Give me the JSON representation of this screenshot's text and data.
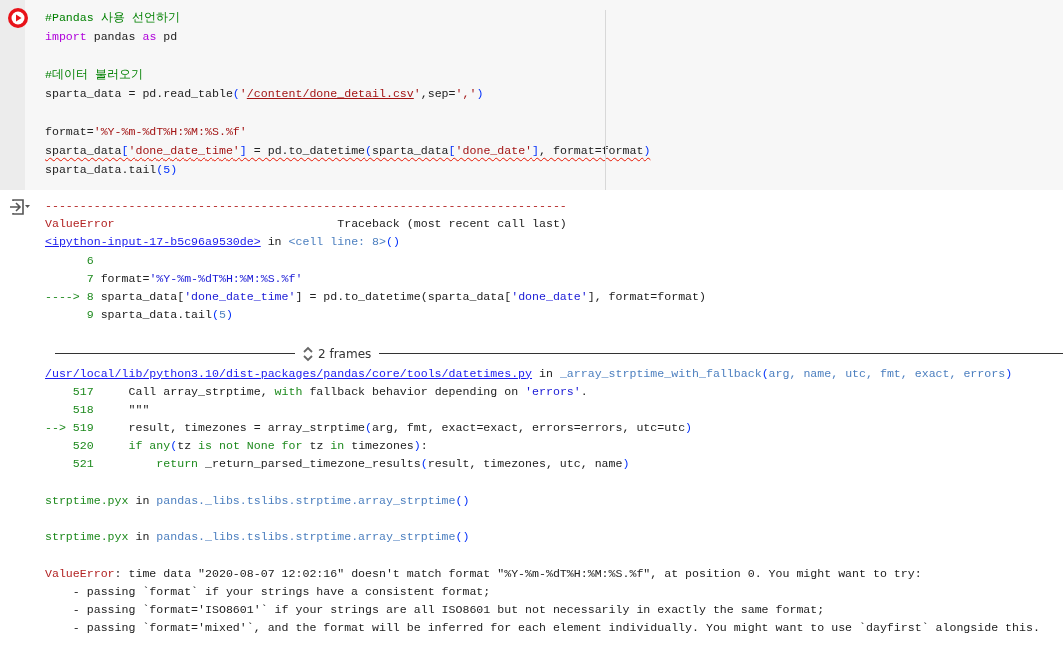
{
  "cell": {
    "lines": [
      {
        "kind": "code",
        "tokens": [
          {
            "kind": "comment",
            "text": "#Pandas 사용 선언하기"
          }
        ]
      },
      {
        "kind": "code",
        "tokens": [
          {
            "kind": "keyword",
            "text": "import"
          },
          {
            "kind": "plain",
            "text": " pandas "
          },
          {
            "kind": "keyword",
            "text": "as"
          },
          {
            "kind": "plain",
            "text": " pd"
          }
        ]
      },
      {
        "kind": "blank"
      },
      {
        "kind": "code",
        "tokens": [
          {
            "kind": "comment",
            "text": "#데이터 불러오기"
          }
        ]
      },
      {
        "kind": "code",
        "tokens": [
          {
            "kind": "plain",
            "text": "sparta_data = pd.read_table"
          },
          {
            "kind": "paren",
            "text": "("
          },
          {
            "kind": "string",
            "text": "'"
          },
          {
            "kind": "strlink",
            "text": "/content/done_detail.csv"
          },
          {
            "kind": "string",
            "text": "'"
          },
          {
            "kind": "plain",
            "text": ",sep="
          },
          {
            "kind": "string",
            "text": "','"
          },
          {
            "kind": "paren",
            "text": ")"
          }
        ]
      },
      {
        "kind": "blank"
      },
      {
        "kind": "code",
        "tokens": [
          {
            "kind": "plain",
            "text": "format="
          },
          {
            "kind": "string",
            "text": "'%Y-%m-%dT%H:%M:%S.%f'"
          }
        ]
      },
      {
        "kind": "code",
        "squiggle": true,
        "tokens": [
          {
            "kind": "plain",
            "text": "sparta_data"
          },
          {
            "kind": "paren",
            "text": "["
          },
          {
            "kind": "string",
            "text": "'done_date_time'"
          },
          {
            "kind": "paren",
            "text": "]"
          },
          {
            "kind": "plain",
            "text": " = pd.to_datetime"
          },
          {
            "kind": "paren",
            "text": "("
          },
          {
            "kind": "plain",
            "text": "sparta_data"
          },
          {
            "kind": "paren",
            "text": "["
          },
          {
            "kind": "string",
            "text": "'done_date'"
          },
          {
            "kind": "paren",
            "text": "]"
          },
          {
            "kind": "plain",
            "text": ", format=format"
          },
          {
            "kind": "paren",
            "text": ")"
          }
        ]
      },
      {
        "kind": "code",
        "tokens": [
          {
            "kind": "plain",
            "text": "sparta_data.tail"
          },
          {
            "kind": "paren",
            "text": "("
          },
          {
            "kind": "number",
            "text": "5"
          },
          {
            "kind": "paren",
            "text": ")"
          }
        ]
      }
    ]
  },
  "output": {
    "lines": [
      {
        "kind": "line",
        "tokens": [
          {
            "kind": "err",
            "text": "---------------------------------------------------------------------------"
          }
        ]
      },
      {
        "kind": "line",
        "tokens": [
          {
            "kind": "err",
            "text": "ValueError"
          },
          {
            "kind": "plain",
            "text": "                                Traceback (most recent call last)"
          }
        ]
      },
      {
        "kind": "line",
        "link": "<ipython-input-17-b5c96a9530de>",
        "tokens": [
          {
            "kind": "plain",
            "text": " in "
          },
          {
            "kind": "func",
            "text": "<cell line: 8>"
          },
          {
            "kind": "paren",
            "text": "()"
          }
        ]
      },
      {
        "kind": "line",
        "tokens": [
          {
            "kind": "green",
            "text": "      6"
          }
        ]
      },
      {
        "kind": "line",
        "tokens": [
          {
            "kind": "green",
            "text": "      7"
          },
          {
            "kind": "plain",
            "text": " format="
          },
          {
            "kind": "str2",
            "text": "'%Y-%m-%dT%H:%M:%S.%f'"
          }
        ]
      },
      {
        "kind": "line",
        "tokens": [
          {
            "kind": "green",
            "text": "----> 8"
          },
          {
            "kind": "plain",
            "text": " sparta_data["
          },
          {
            "kind": "str2",
            "text": "'done_date_time'"
          },
          {
            "kind": "plain",
            "text": "] = pd.to_datetime(sparta_data["
          },
          {
            "kind": "str2",
            "text": "'done_date'"
          },
          {
            "kind": "plain",
            "text": "], format=format)"
          }
        ]
      },
      {
        "kind": "line",
        "tokens": [
          {
            "kind": "green",
            "text": "      9"
          },
          {
            "kind": "plain",
            "text": " sparta_data.tail"
          },
          {
            "kind": "paren",
            "text": "("
          },
          {
            "kind": "func",
            "text": "5"
          },
          {
            "kind": "paren",
            "text": ")"
          }
        ]
      },
      {
        "kind": "blank"
      },
      {
        "kind": "frames",
        "text": "2 frames"
      },
      {
        "kind": "line",
        "link": "/usr/local/lib/python3.10/dist-packages/pandas/core/tools/datetimes.py",
        "tokens": [
          {
            "kind": "plain",
            "text": " in "
          },
          {
            "kind": "func",
            "text": "_array_strptime_with_fallback"
          },
          {
            "kind": "paren",
            "text": "("
          },
          {
            "kind": "func",
            "text": "arg, name, utc, fmt, exact, errors"
          },
          {
            "kind": "paren",
            "text": ")"
          }
        ]
      },
      {
        "kind": "line",
        "tokens": [
          {
            "kind": "green",
            "text": "    517"
          },
          {
            "kind": "plain",
            "text": "     Call array_strptime, "
          },
          {
            "kind": "green",
            "text": "with"
          },
          {
            "kind": "plain",
            "text": " fallback behavior depending on "
          },
          {
            "kind": "str2",
            "text": "'errors'"
          },
          {
            "kind": "plain",
            "text": "."
          }
        ]
      },
      {
        "kind": "line",
        "tokens": [
          {
            "kind": "green",
            "text": "    518"
          },
          {
            "kind": "plain",
            "text": "     \"\"\""
          }
        ]
      },
      {
        "kind": "line",
        "tokens": [
          {
            "kind": "green",
            "text": "--> 519"
          },
          {
            "kind": "plain",
            "text": "     result, timezones = array_strptime"
          },
          {
            "kind": "paren",
            "text": "("
          },
          {
            "kind": "plain",
            "text": "arg, fmt, exact=exact, errors=errors, utc=utc"
          },
          {
            "kind": "paren",
            "text": ")"
          }
        ]
      },
      {
        "kind": "line",
        "tokens": [
          {
            "kind": "green",
            "text": "    520     "
          },
          {
            "kind": "green",
            "text": "if any"
          },
          {
            "kind": "paren",
            "text": "("
          },
          {
            "kind": "plain",
            "text": "tz "
          },
          {
            "kind": "green",
            "text": "is not None for"
          },
          {
            "kind": "plain",
            "text": " tz "
          },
          {
            "kind": "green",
            "text": "in"
          },
          {
            "kind": "plain",
            "text": " timezones"
          },
          {
            "kind": "paren",
            "text": ")"
          },
          {
            "kind": "plain",
            "text": ":"
          }
        ]
      },
      {
        "kind": "line",
        "tokens": [
          {
            "kind": "green",
            "text": "    521         return"
          },
          {
            "kind": "plain",
            "text": " _return_parsed_timezone_results"
          },
          {
            "kind": "paren",
            "text": "("
          },
          {
            "kind": "plain",
            "text": "result, timezones, utc, name"
          },
          {
            "kind": "paren",
            "text": ")"
          }
        ]
      },
      {
        "kind": "blank"
      },
      {
        "kind": "line",
        "tokens": [
          {
            "kind": "green",
            "text": "strptime.pyx"
          },
          {
            "kind": "plain",
            "text": " in "
          },
          {
            "kind": "func",
            "text": "pandas._libs.tslibs.strptime.array_strptime"
          },
          {
            "kind": "paren",
            "text": "()"
          }
        ]
      },
      {
        "kind": "blank"
      },
      {
        "kind": "line",
        "tokens": [
          {
            "kind": "green",
            "text": "strptime.pyx"
          },
          {
            "kind": "plain",
            "text": " in "
          },
          {
            "kind": "func",
            "text": "pandas._libs.tslibs.strptime.array_strptime"
          },
          {
            "kind": "paren",
            "text": "()"
          }
        ]
      },
      {
        "kind": "blank"
      },
      {
        "kind": "line",
        "tokens": [
          {
            "kind": "err",
            "text": "ValueError"
          },
          {
            "kind": "plain",
            "text": ": time data \"2020-08-07 12:02:16\" doesn't match format \"%Y-%m-%dT%H:%M:%S.%f\", at position 0. You might want to try:"
          }
        ]
      },
      {
        "kind": "line",
        "tokens": [
          {
            "kind": "plain",
            "text": "    - passing `format` if your strings have a consistent format;"
          }
        ]
      },
      {
        "kind": "line",
        "tokens": [
          {
            "kind": "plain",
            "text": "    - passing `format='ISO8601'` if your strings are all ISO8601 but not necessarily in exactly the same format;"
          }
        ]
      },
      {
        "kind": "line",
        "tokens": [
          {
            "kind": "plain",
            "text": "    - passing `format='mixed'`, and the format will be inferred for each element individually. You might want to use `dayfirst` alongside this."
          }
        ]
      }
    ]
  }
}
